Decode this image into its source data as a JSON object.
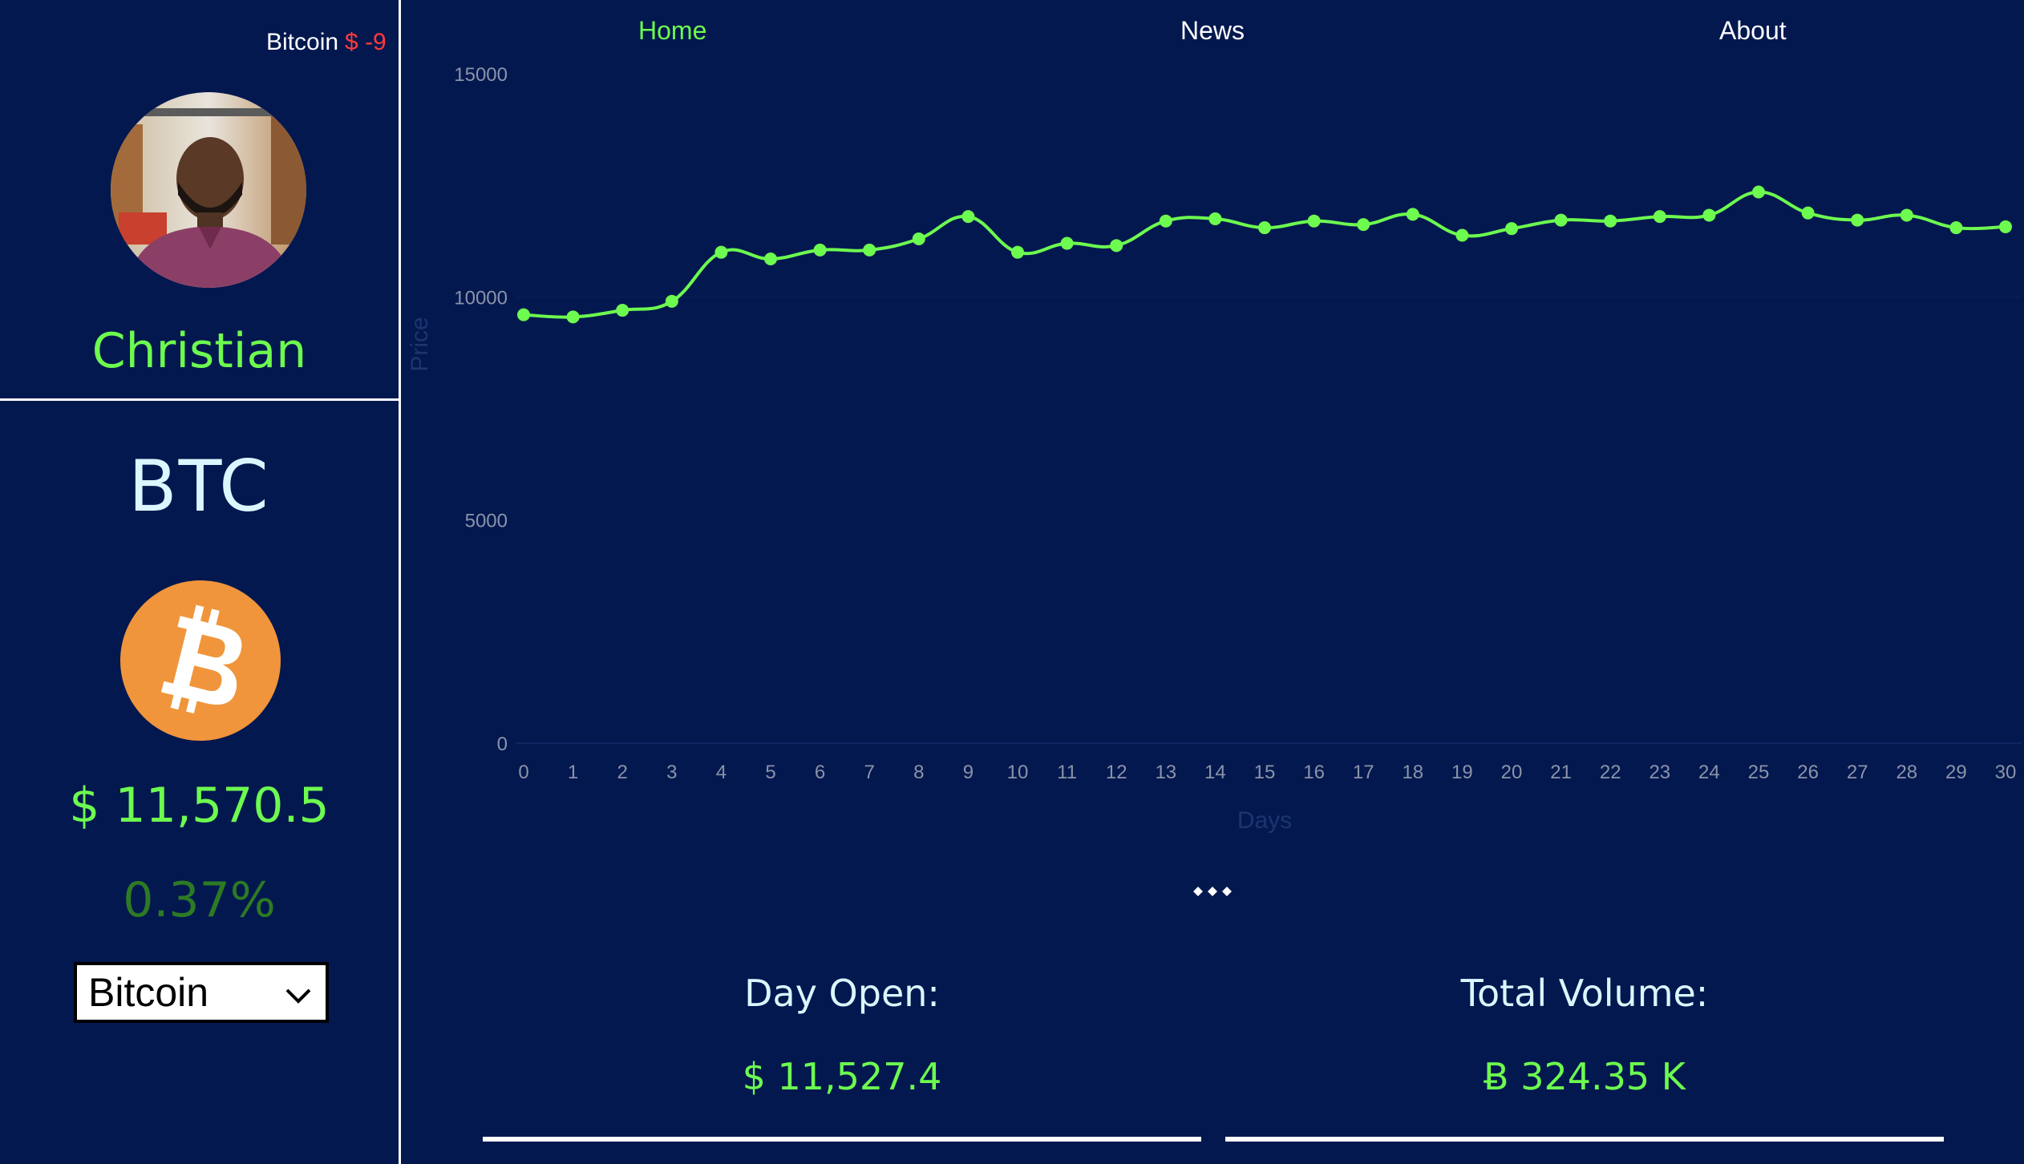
{
  "ticker": {
    "coin": "Bitcoin",
    "change_text": "$ -9"
  },
  "nav": {
    "home": "Home",
    "news": "News",
    "about": "About"
  },
  "profile": {
    "name": "Christian"
  },
  "coin": {
    "symbol": "BTC",
    "price": "$ 11,570.5",
    "change_pct": "0.37%",
    "selected": "Bitcoin"
  },
  "stats": {
    "day_open_label": "Day Open:",
    "day_open_value": "$ 11,527.4",
    "total_volume_label": "Total Volume:",
    "total_volume_value": "Ƀ 324.35 K"
  },
  "colors": {
    "background": "#03184f",
    "accent_green": "#6dfb4f",
    "dark_green": "#2d7a24",
    "negative_red": "#ff3b3b",
    "text_light": "#dbf6ff",
    "bitcoin_orange": "#f0953b"
  },
  "chart_data": {
    "type": "line",
    "xlabel": "Days",
    "ylabel": "Price",
    "ylim": [
      0,
      15000
    ],
    "yticks": [
      0,
      5000,
      10000,
      15000
    ],
    "x": [
      0,
      1,
      2,
      3,
      4,
      5,
      6,
      7,
      8,
      9,
      10,
      11,
      12,
      13,
      14,
      15,
      16,
      17,
      18,
      19,
      20,
      21,
      22,
      23,
      24,
      25,
      26,
      27,
      28,
      29,
      30
    ],
    "series": [
      {
        "values": [
          9600,
          9550,
          9700,
          9900,
          11000,
          10850,
          11050,
          11050,
          11300,
          11800,
          11000,
          11200,
          11150,
          11700,
          11750,
          11550,
          11700,
          11620,
          11850,
          11380,
          11530,
          11720,
          11700,
          11800,
          11830,
          12350,
          11880,
          11720,
          11830,
          11550,
          11570
        ],
        "color": "#6dfb4f"
      }
    ],
    "grid": false,
    "legend": "none"
  }
}
